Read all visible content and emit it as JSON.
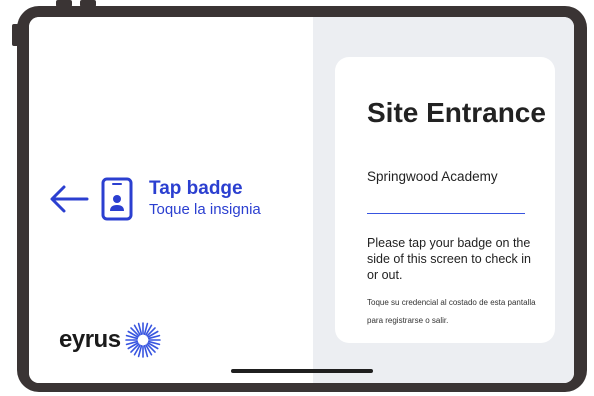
{
  "tap": {
    "title": "Tap badge",
    "subtitle": "Toque la insignia"
  },
  "brand": {
    "name": "eyrus"
  },
  "card": {
    "title": "Site Entrance",
    "location": "Springwood Academy",
    "instructions": "Please tap your badge on the side of this screen to check in or out.",
    "instructions_es": "Toque su credencial al costado de esta pantalla para registrarse o salir."
  },
  "icons": {
    "arrow": "arrow-left-icon",
    "badge": "phone-badge-icon",
    "logo": "sunburst-logo-icon"
  },
  "colors": {
    "accent": "#2b3fd0",
    "frame": "#3a3434",
    "panel": "#eceef2",
    "divider": "#3855e0"
  }
}
